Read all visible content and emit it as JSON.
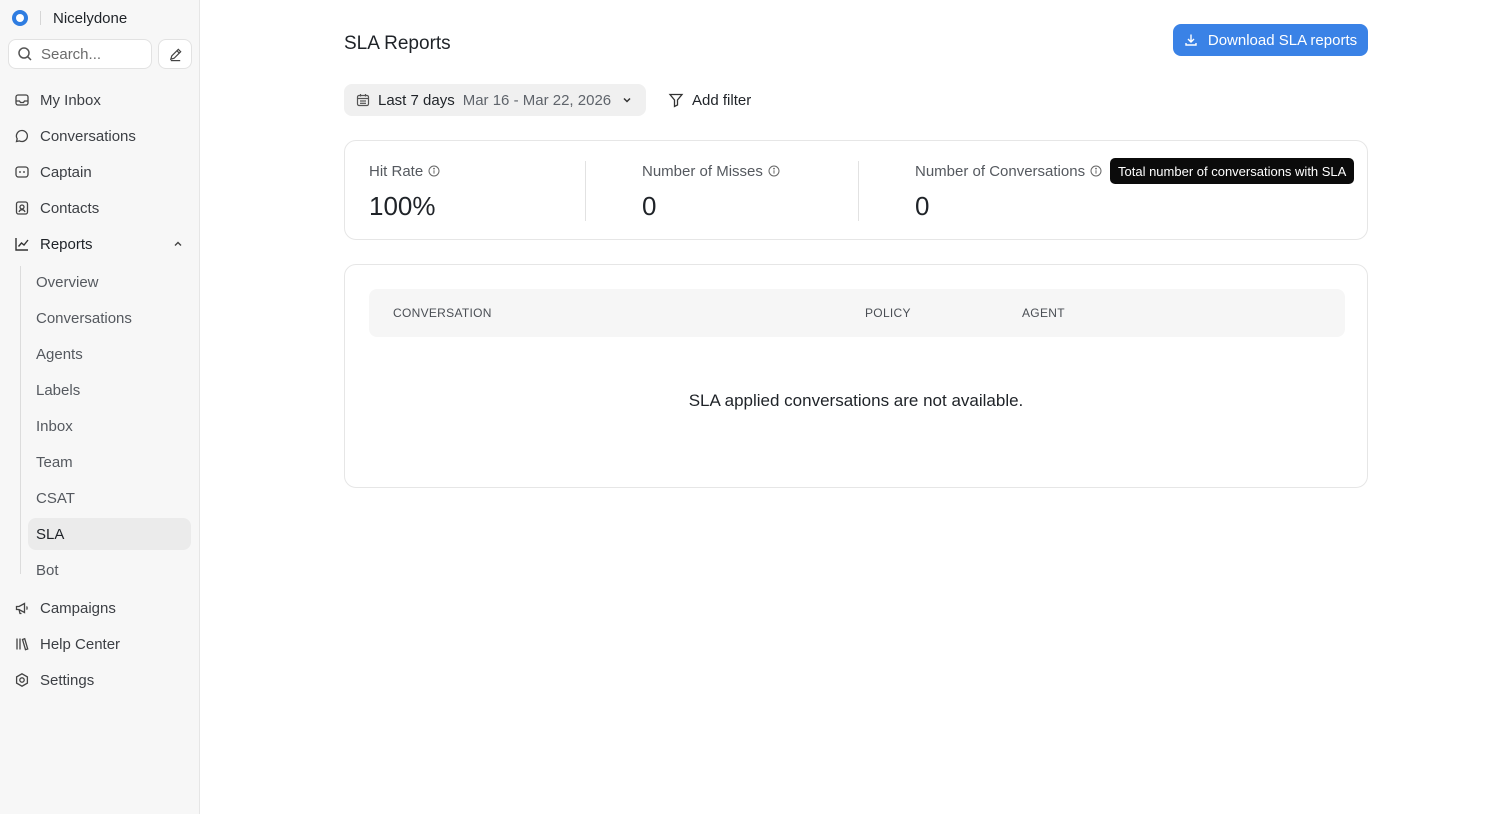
{
  "brand": {
    "name": "Nicelydone",
    "logo_color": "#2f7de1"
  },
  "search": {
    "placeholder": "Search..."
  },
  "nav": {
    "my_inbox": "My Inbox",
    "conversations": "Conversations",
    "captain": "Captain",
    "contacts": "Contacts",
    "reports": "Reports",
    "campaigns": "Campaigns",
    "help_center": "Help Center",
    "settings": "Settings"
  },
  "reports_sub": [
    "Overview",
    "Conversations",
    "Agents",
    "Labels",
    "Inbox",
    "Team",
    "CSAT",
    "SLA",
    "Bot"
  ],
  "reports_active": "SLA",
  "header": {
    "title": "SLA Reports",
    "download_label": "Download SLA reports",
    "accent_color": "#3a82e6"
  },
  "filters": {
    "range_name": "Last 7 days",
    "range_dates": "Mar 16 - Mar 22, 2026",
    "add_filter_label": "Add filter"
  },
  "metrics": {
    "hit_rate": {
      "label": "Hit Rate",
      "value": "100%"
    },
    "misses": {
      "label": "Number of Misses",
      "value": "0"
    },
    "conversations": {
      "label": "Number of Conversations",
      "value": "0"
    },
    "tooltip": "Total number of conversations with SLA"
  },
  "table": {
    "columns": [
      "CONVERSATION",
      "POLICY",
      "AGENT"
    ],
    "empty_message": "SLA applied conversations are not available."
  }
}
